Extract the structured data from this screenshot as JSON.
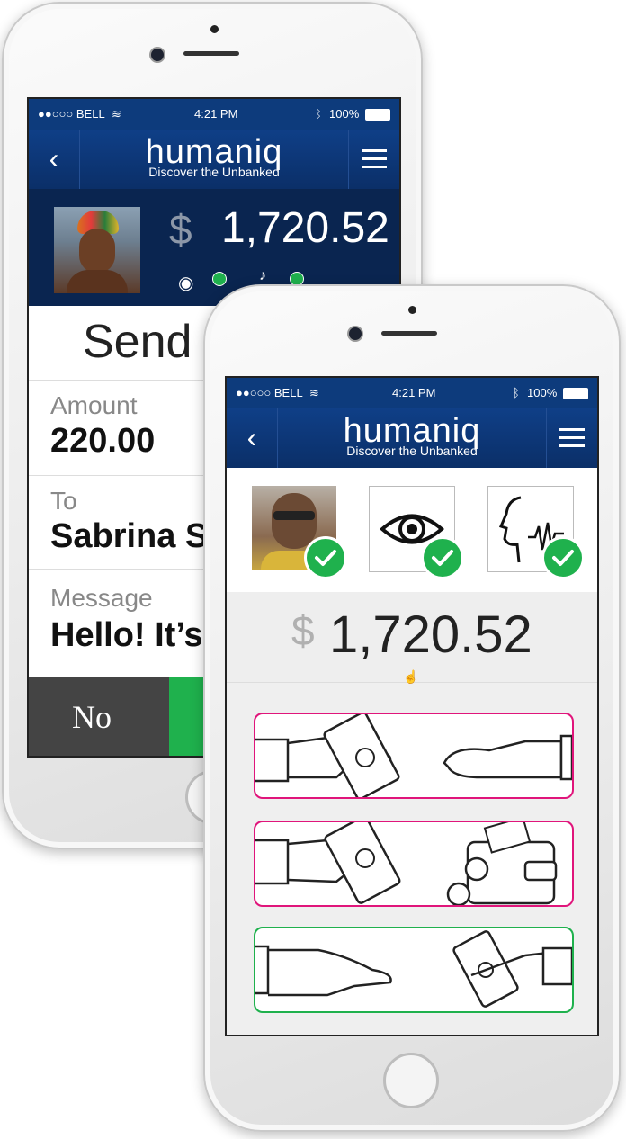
{
  "back_phone": {
    "status": {
      "carrier": "●●○○○ BELL",
      "time": "4:21 PM",
      "battery": "100%"
    },
    "nav": {
      "logo": "humaniq",
      "tagline": "Discover the Unbanked"
    },
    "balance": {
      "currency": "$",
      "amount": "1,720.52"
    },
    "send_title": "Send",
    "fields": {
      "amount_label": "Amount",
      "amount_value": "220.00",
      "to_label": "To",
      "to_value": "Sabrina S",
      "message_label": "Message",
      "message_value": "Hello! It’s"
    },
    "no_label": "No"
  },
  "front_phone": {
    "status": {
      "carrier": "●●○○○ BELL",
      "time": "4:21 PM",
      "battery": "100%"
    },
    "nav": {
      "logo": "humaniq",
      "tagline": "Discover the Unbanked"
    },
    "balance": {
      "currency": "$",
      "amount": "1,720.52"
    },
    "verification": [
      {
        "icon": "face-photo",
        "verified": true
      },
      {
        "icon": "eye-icon",
        "verified": true
      },
      {
        "icon": "voice-icon",
        "verified": true
      }
    ],
    "actions": [
      {
        "icon": "send-money-icon",
        "border": "#e0157b"
      },
      {
        "icon": "deposit-wallet-icon",
        "border": "#e0157b"
      },
      {
        "icon": "receive-money-icon",
        "border": "#1fb14d"
      }
    ]
  },
  "colors": {
    "nav": "#0d3b7c",
    "accent_pink": "#e0157b",
    "accent_green": "#1fb14d",
    "no_button": "#444444"
  }
}
